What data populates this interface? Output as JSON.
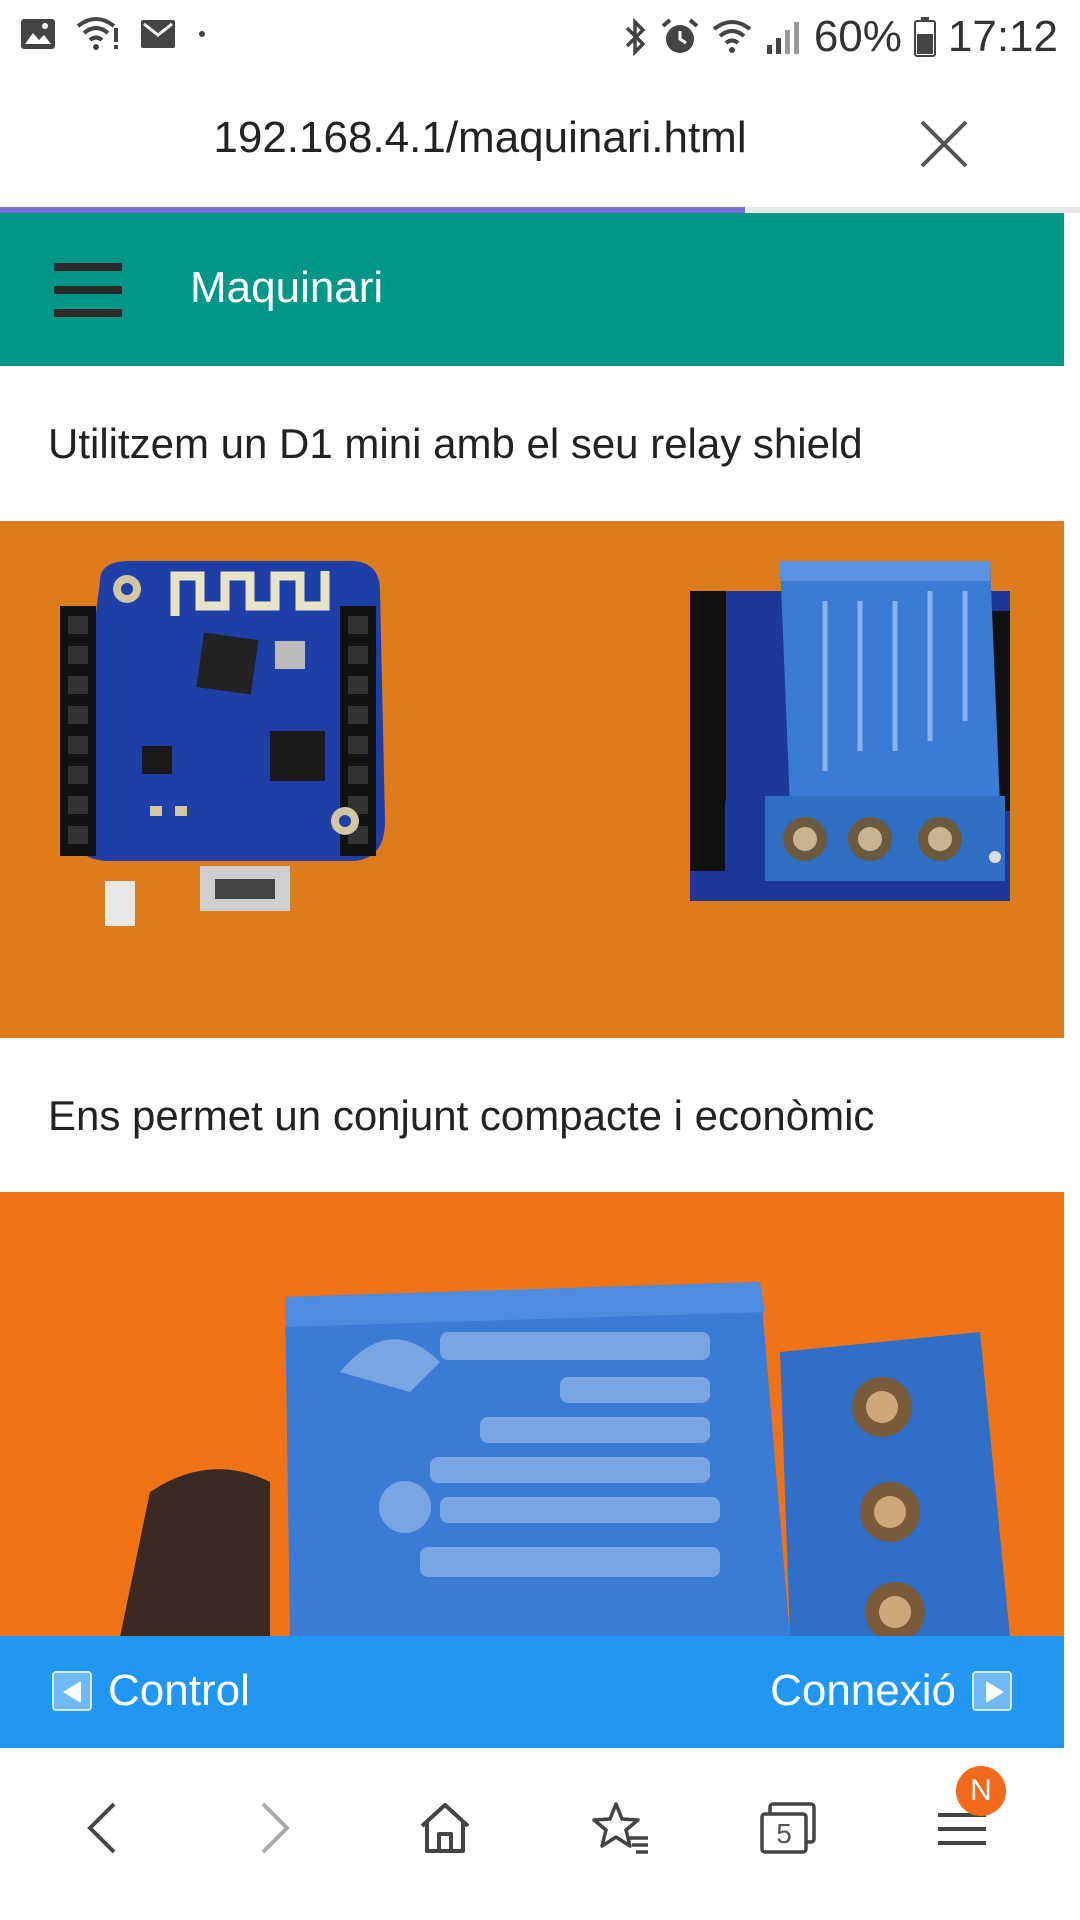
{
  "status_bar": {
    "battery": "60%",
    "time": "17:12",
    "left_icons": [
      "gallery-icon",
      "wifi-alert-icon",
      "mail-icon",
      "dot-icon"
    ],
    "right_icons": [
      "bluetooth-icon",
      "alarm-icon",
      "wifi-icon",
      "signal-icon",
      "battery-icon"
    ]
  },
  "browser": {
    "url": "192.168.4.1/maquinari.html",
    "load_progress": 0.69,
    "tab_count": "5",
    "menu_badge": "N"
  },
  "app": {
    "header_title": "Maquinari",
    "paragraphs": [
      "Utilitzem un D1 mini amb el seu relay shield",
      "Ens permet un conjunt compacte i econòmic"
    ],
    "nav": {
      "prev_label": "Control",
      "next_label": "Connexió"
    }
  },
  "colors": {
    "header": "#009688",
    "footer_nav": "#2196f3",
    "progress": "#7b6fd6",
    "photo_background": "#e07d1e",
    "board_blue": "#1f3fa8",
    "relay_blue": "#3a7bd5",
    "badge": "#f26a1b"
  }
}
